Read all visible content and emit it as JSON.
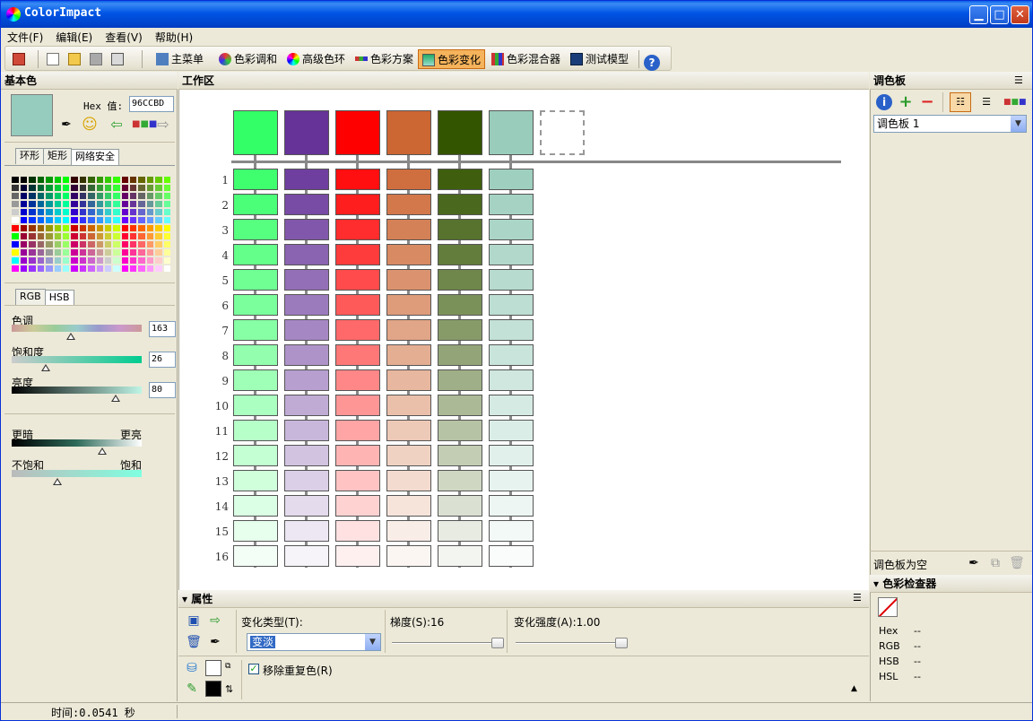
{
  "app": {
    "title": "ColorImpact"
  },
  "menu": [
    "文件(F)",
    "编辑(E)",
    "查看(V)",
    "帮助(H)"
  ],
  "toolbar": {
    "items": [
      "主菜单",
      "色彩调和",
      "高级色环",
      "色彩方案",
      "色彩变化",
      "色彩混合器",
      "测试模型"
    ],
    "active": "色彩变化"
  },
  "base_color": {
    "header": "基本色",
    "hex_label": "Hex 值:",
    "hex_value": "96CCBD",
    "swatch_color": "#96ccbd"
  },
  "palette_tabs": [
    "环形",
    "矩形",
    "网络安全"
  ],
  "model_tabs": [
    "RGB",
    "HSB"
  ],
  "hsb": {
    "hue": {
      "label": "色调",
      "value": "163"
    },
    "saturation": {
      "label": "饱和度",
      "value": "26"
    },
    "brightness": {
      "label": "亮度",
      "value": "80"
    }
  },
  "adjust": {
    "darker": "更暗",
    "brighter": "更亮",
    "unsaturated": "不饱和",
    "saturated": "饱和"
  },
  "workspace": {
    "header": "工作区",
    "base_colors": [
      "#33ff66",
      "#663399",
      "#ff0000",
      "#cc6633",
      "#335500",
      "#99ccbb"
    ],
    "row_numbers": [
      "1",
      "2",
      "3",
      "4",
      "5",
      "6",
      "7",
      "8",
      "9",
      "10",
      "11",
      "12",
      "13",
      "14",
      "15",
      "16"
    ]
  },
  "properties": {
    "header": "属性",
    "variation_type_label": "变化类型(T):",
    "variation_type_value": "变淡",
    "gradient_label": "梯度(S):16",
    "gradient_level": 1.0,
    "strength_label": "变化强度(A):1.00",
    "strength_level": 1.0,
    "remove_duplicates_label": "移除重复色(R)"
  },
  "palette_panel": {
    "header": "调色板",
    "selected": "调色板 1",
    "empty_text": "调色板为空"
  },
  "inspector": {
    "header": "色彩检查器",
    "rows": [
      {
        "label": "Hex",
        "value": "--"
      },
      {
        "label": "RGB",
        "value": "--"
      },
      {
        "label": "HSB",
        "value": "--"
      },
      {
        "label": "HSL",
        "value": "--"
      }
    ]
  },
  "status": {
    "text": "时间:0.0541 秒"
  }
}
